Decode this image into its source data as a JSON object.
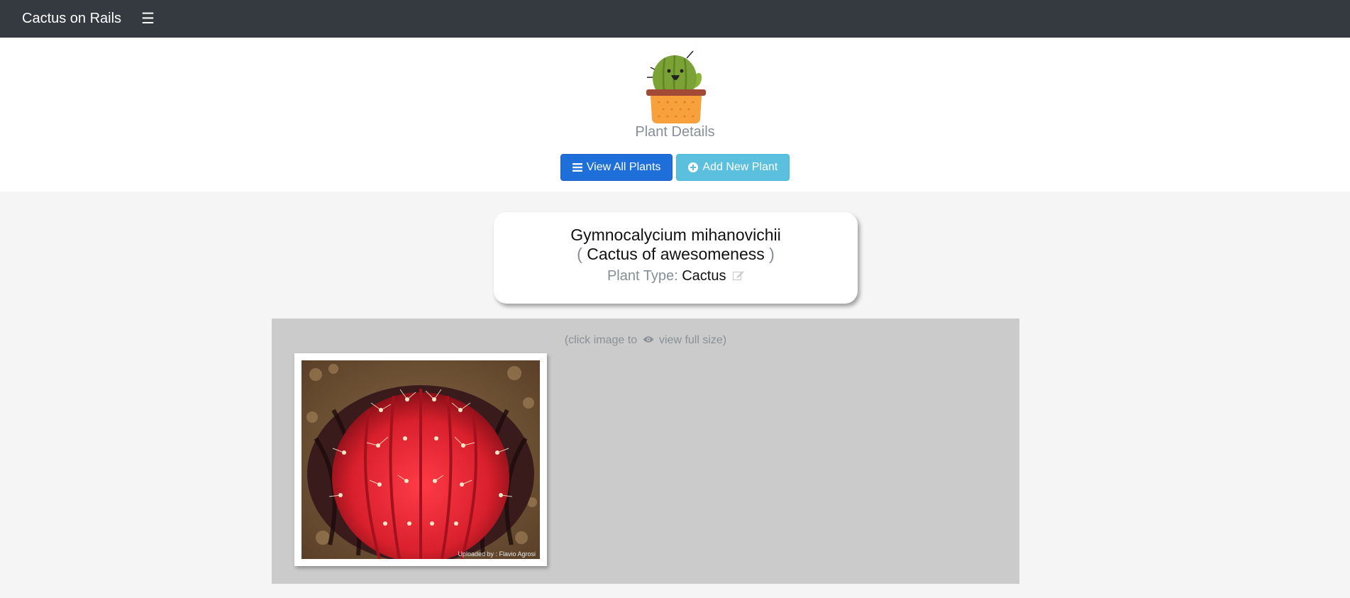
{
  "navbar": {
    "brand": "Cactus on Rails",
    "menu_icon": "hamburger-menu-icon"
  },
  "header": {
    "subtitle": "Plant Details",
    "logo_icon": "cactus-logo-icon",
    "buttons": {
      "view_all": "View All Plants",
      "view_all_icon": "list-icon",
      "add_new": "Add New Plant",
      "add_new_icon": "plus-circle-icon"
    }
  },
  "plant": {
    "scientific_name": "Gymnocalycium mihanovichii",
    "open_paren": "(",
    "common_name": "Cactus of awesomeness",
    "close_paren": ")",
    "type_label": "Plant Type:",
    "type_value": "Cactus",
    "edit_icon": "edit-icon"
  },
  "gallery": {
    "hint_prefix": "(click image to",
    "hint_suffix": "view full size)",
    "hint_icon": "eye-icon",
    "photo_watermark": "Uploaded by : Flavio Agrosi"
  },
  "colors": {
    "navbar_bg": "#343a40",
    "primary": "#1e6fd9",
    "info": "#5bc0de",
    "gallery_bg": "#cbcbcb"
  }
}
